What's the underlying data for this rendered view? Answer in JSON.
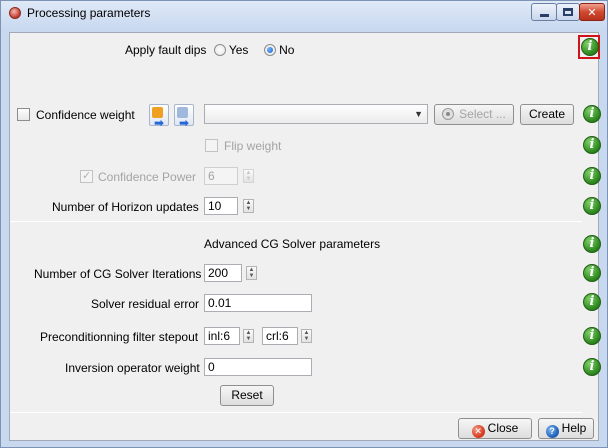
{
  "window": {
    "title": "Processing parameters",
    "close_glyph": "✕"
  },
  "fault_dips": {
    "label": "Apply fault dips",
    "yes_label": "Yes",
    "no_label": "No",
    "selected": "No"
  },
  "confidence": {
    "label": "Confidence weight",
    "checked": false,
    "combo_value": "",
    "select_label": "Select ...",
    "create_label": "Create",
    "flip_label": "Flip weight",
    "power_label": "Confidence Power",
    "power_value": "6"
  },
  "horizon": {
    "label": "Number of Horizon updates",
    "value": "10"
  },
  "cg": {
    "section_title": "Advanced CG Solver parameters",
    "iterations_label": "Number of CG Solver Iterations",
    "iterations_value": "200",
    "residual_label": "Solver residual error",
    "residual_value": "0.01",
    "filter_label": "Preconditionning filter stepout",
    "inl_value": "inl:6",
    "crl_value": "crl:6",
    "inversion_label": "Inversion operator weight",
    "inversion_value": "0",
    "reset_label": "Reset"
  },
  "footer": {
    "close_label": "Close",
    "help_label": "Help"
  },
  "icons": {
    "info": "i",
    "spin_up": "▲",
    "spin_down": "▼",
    "combo_arrow": "▼",
    "check": "✓",
    "arrow": "➡",
    "close_x": "✕",
    "help_q": "?"
  },
  "colors": {
    "info_green": "#2f8a1f",
    "highlight_red": "#d0121b",
    "title_bar": "#c7d8ef"
  }
}
